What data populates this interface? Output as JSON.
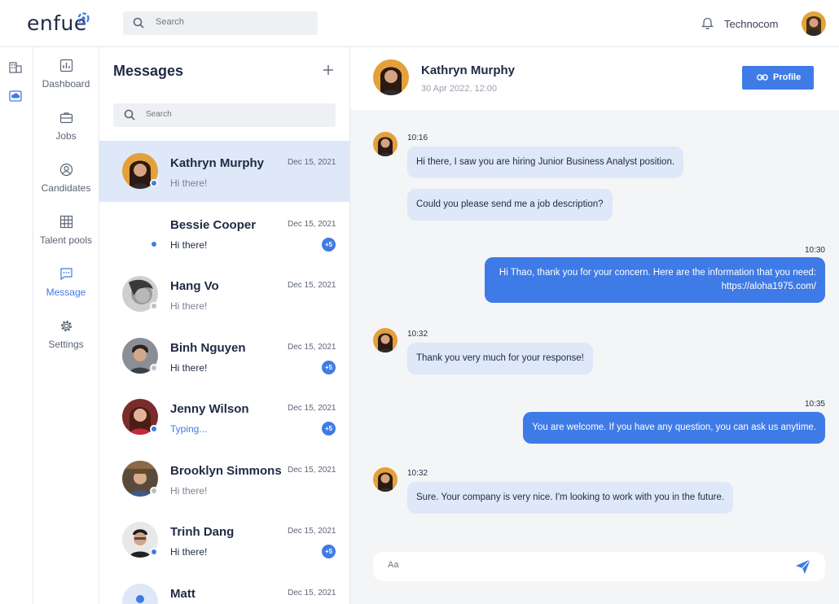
{
  "brand": {
    "logo_text": "enfue"
  },
  "topbar": {
    "search_placeholder": "Search",
    "company": "Technocom"
  },
  "nav": [
    {
      "id": "dashboard",
      "label": "Dashboard",
      "icon": "chart-icon"
    },
    {
      "id": "jobs",
      "label": "Jobs",
      "icon": "briefcase-icon"
    },
    {
      "id": "candidates",
      "label": "Candidates",
      "icon": "user-circle-icon"
    },
    {
      "id": "talent",
      "label": "Talent pools",
      "icon": "grid-icon"
    },
    {
      "id": "message",
      "label": "Message",
      "icon": "chat-icon",
      "active": true
    },
    {
      "id": "settings",
      "label": "Settings",
      "icon": "gear-icon"
    }
  ],
  "messages_panel": {
    "title": "Messages",
    "search_placeholder": "Search",
    "conversations": [
      {
        "name": "Kathryn Murphy",
        "date": "Dec 15, 2021",
        "preview": "Hi there!",
        "status": "online",
        "badge": "",
        "state": "read",
        "active": true
      },
      {
        "name": "Bessie Cooper",
        "date": "Dec 15, 2021",
        "preview": "Hi there!",
        "status": "online",
        "badge": "+5",
        "state": "unread"
      },
      {
        "name": "Hang Vo",
        "date": "Dec 15, 2021",
        "preview": "Hi there!",
        "status": "offline",
        "badge": "",
        "state": "read"
      },
      {
        "name": "Binh Nguyen",
        "date": "Dec 15, 2021",
        "preview": "Hi there!",
        "status": "offline",
        "badge": "+5",
        "state": "unread"
      },
      {
        "name": "Jenny Wilson",
        "date": "Dec 15, 2021",
        "preview": "Typing...",
        "status": "online",
        "badge": "+5",
        "state": "typing"
      },
      {
        "name": "Brooklyn Simmons",
        "date": "Dec 15, 2021",
        "preview": "Hi there!",
        "status": "offline",
        "badge": "",
        "state": "read"
      },
      {
        "name": "Trinh Dang",
        "date": "Dec 15, 2021",
        "preview": "Hi there!",
        "status": "online",
        "badge": "+5",
        "state": "unread"
      },
      {
        "name": "Matt",
        "date": "Dec 15, 2021",
        "preview": "",
        "status": "online",
        "badge": "",
        "state": "read"
      }
    ]
  },
  "chat": {
    "contact_name": "Kathryn Murphy",
    "contact_date": "30 Apr 2022, 12:00",
    "profile_label": "Profile",
    "composer_placeholder": "Aa",
    "messages": [
      {
        "dir": "in",
        "time": "10:16",
        "text": "Hi there, I saw you are hiring Junior Business Analyst position."
      },
      {
        "dir": "in",
        "time": "",
        "text": "Could you please send me a job description?"
      },
      {
        "dir": "out",
        "time": "10:30",
        "text": "Hi Thao, thank you for your concern. Here are the information that you need:",
        "text2": "https://aloha1975.com/"
      },
      {
        "dir": "in",
        "time": "10:32",
        "text": "Thank you very much for your response!"
      },
      {
        "dir": "out",
        "time": "10:35",
        "text": "You are welcome. If you have any question, you can ask us anytime."
      },
      {
        "dir": "in",
        "time": "10:32",
        "text": "Sure. Your company is very nice. I'm looking to work with you in the future."
      }
    ]
  },
  "colors": {
    "accent": "#3f7be6",
    "bubble_in": "#dfe8f8",
    "chat_bg": "#f4f5f7"
  }
}
